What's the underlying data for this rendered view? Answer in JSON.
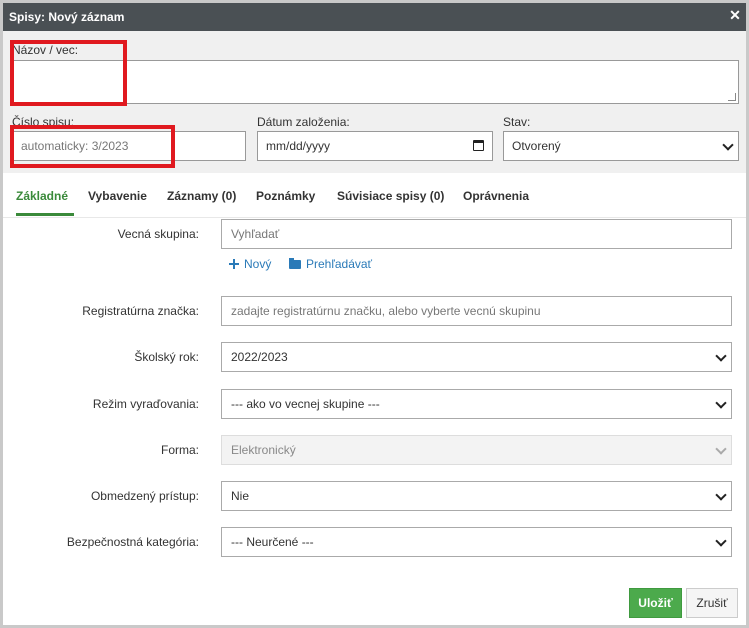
{
  "dialog": {
    "title": "Spisy: Nový záznam",
    "close_icon": "close-icon"
  },
  "header_form": {
    "name_label": "Názov / vec:",
    "name_value": "",
    "file_number_label": "Číslo spisu:",
    "file_number_placeholder": "automaticky: 3/2023",
    "date_label": "Dátum založenia:",
    "date_placeholder": "mm/dd/yyyy",
    "state_label": "Stav:",
    "state_value": "Otvorený"
  },
  "tabs": [
    {
      "label": "Základné",
      "active": true
    },
    {
      "label": "Vybavenie",
      "active": false
    },
    {
      "label": "Záznamy (0)",
      "active": false
    },
    {
      "label": "Poznámky",
      "active": false
    },
    {
      "label": "Súvisiace spisy (0)",
      "active": false
    },
    {
      "label": "Oprávnenia",
      "active": false
    }
  ],
  "fields": {
    "subject_group": {
      "label": "Vecná skupina:",
      "placeholder": "Vyhľadať"
    },
    "new_link": "Nový",
    "browse_link": "Prehľadávať",
    "registry_mark": {
      "label": "Registratúrna značka:",
      "placeholder": "zadajte registratúrnu značku, alebo vyberte vecnú skupinu"
    },
    "school_year": {
      "label": "Školský rok:",
      "value": "2022/2023"
    },
    "disposal_mode": {
      "label": "Režim vyraďovania:",
      "value": "--- ako vo vecnej skupine ---"
    },
    "form": {
      "label": "Forma:",
      "value": "Elektronický"
    },
    "restricted_access": {
      "label": "Obmedzený prístup:",
      "value": "Nie"
    },
    "security_category": {
      "label": "Bezpečnostná kategória:",
      "value": "--- Neurčené ---"
    }
  },
  "buttons": {
    "save": "Uložiť",
    "cancel": "Zrušiť"
  },
  "colors": {
    "titlebar": "#4a5054",
    "accent_green": "#3a8a3a",
    "link_blue": "#2a7ab8",
    "highlight_red": "#e0191f"
  }
}
